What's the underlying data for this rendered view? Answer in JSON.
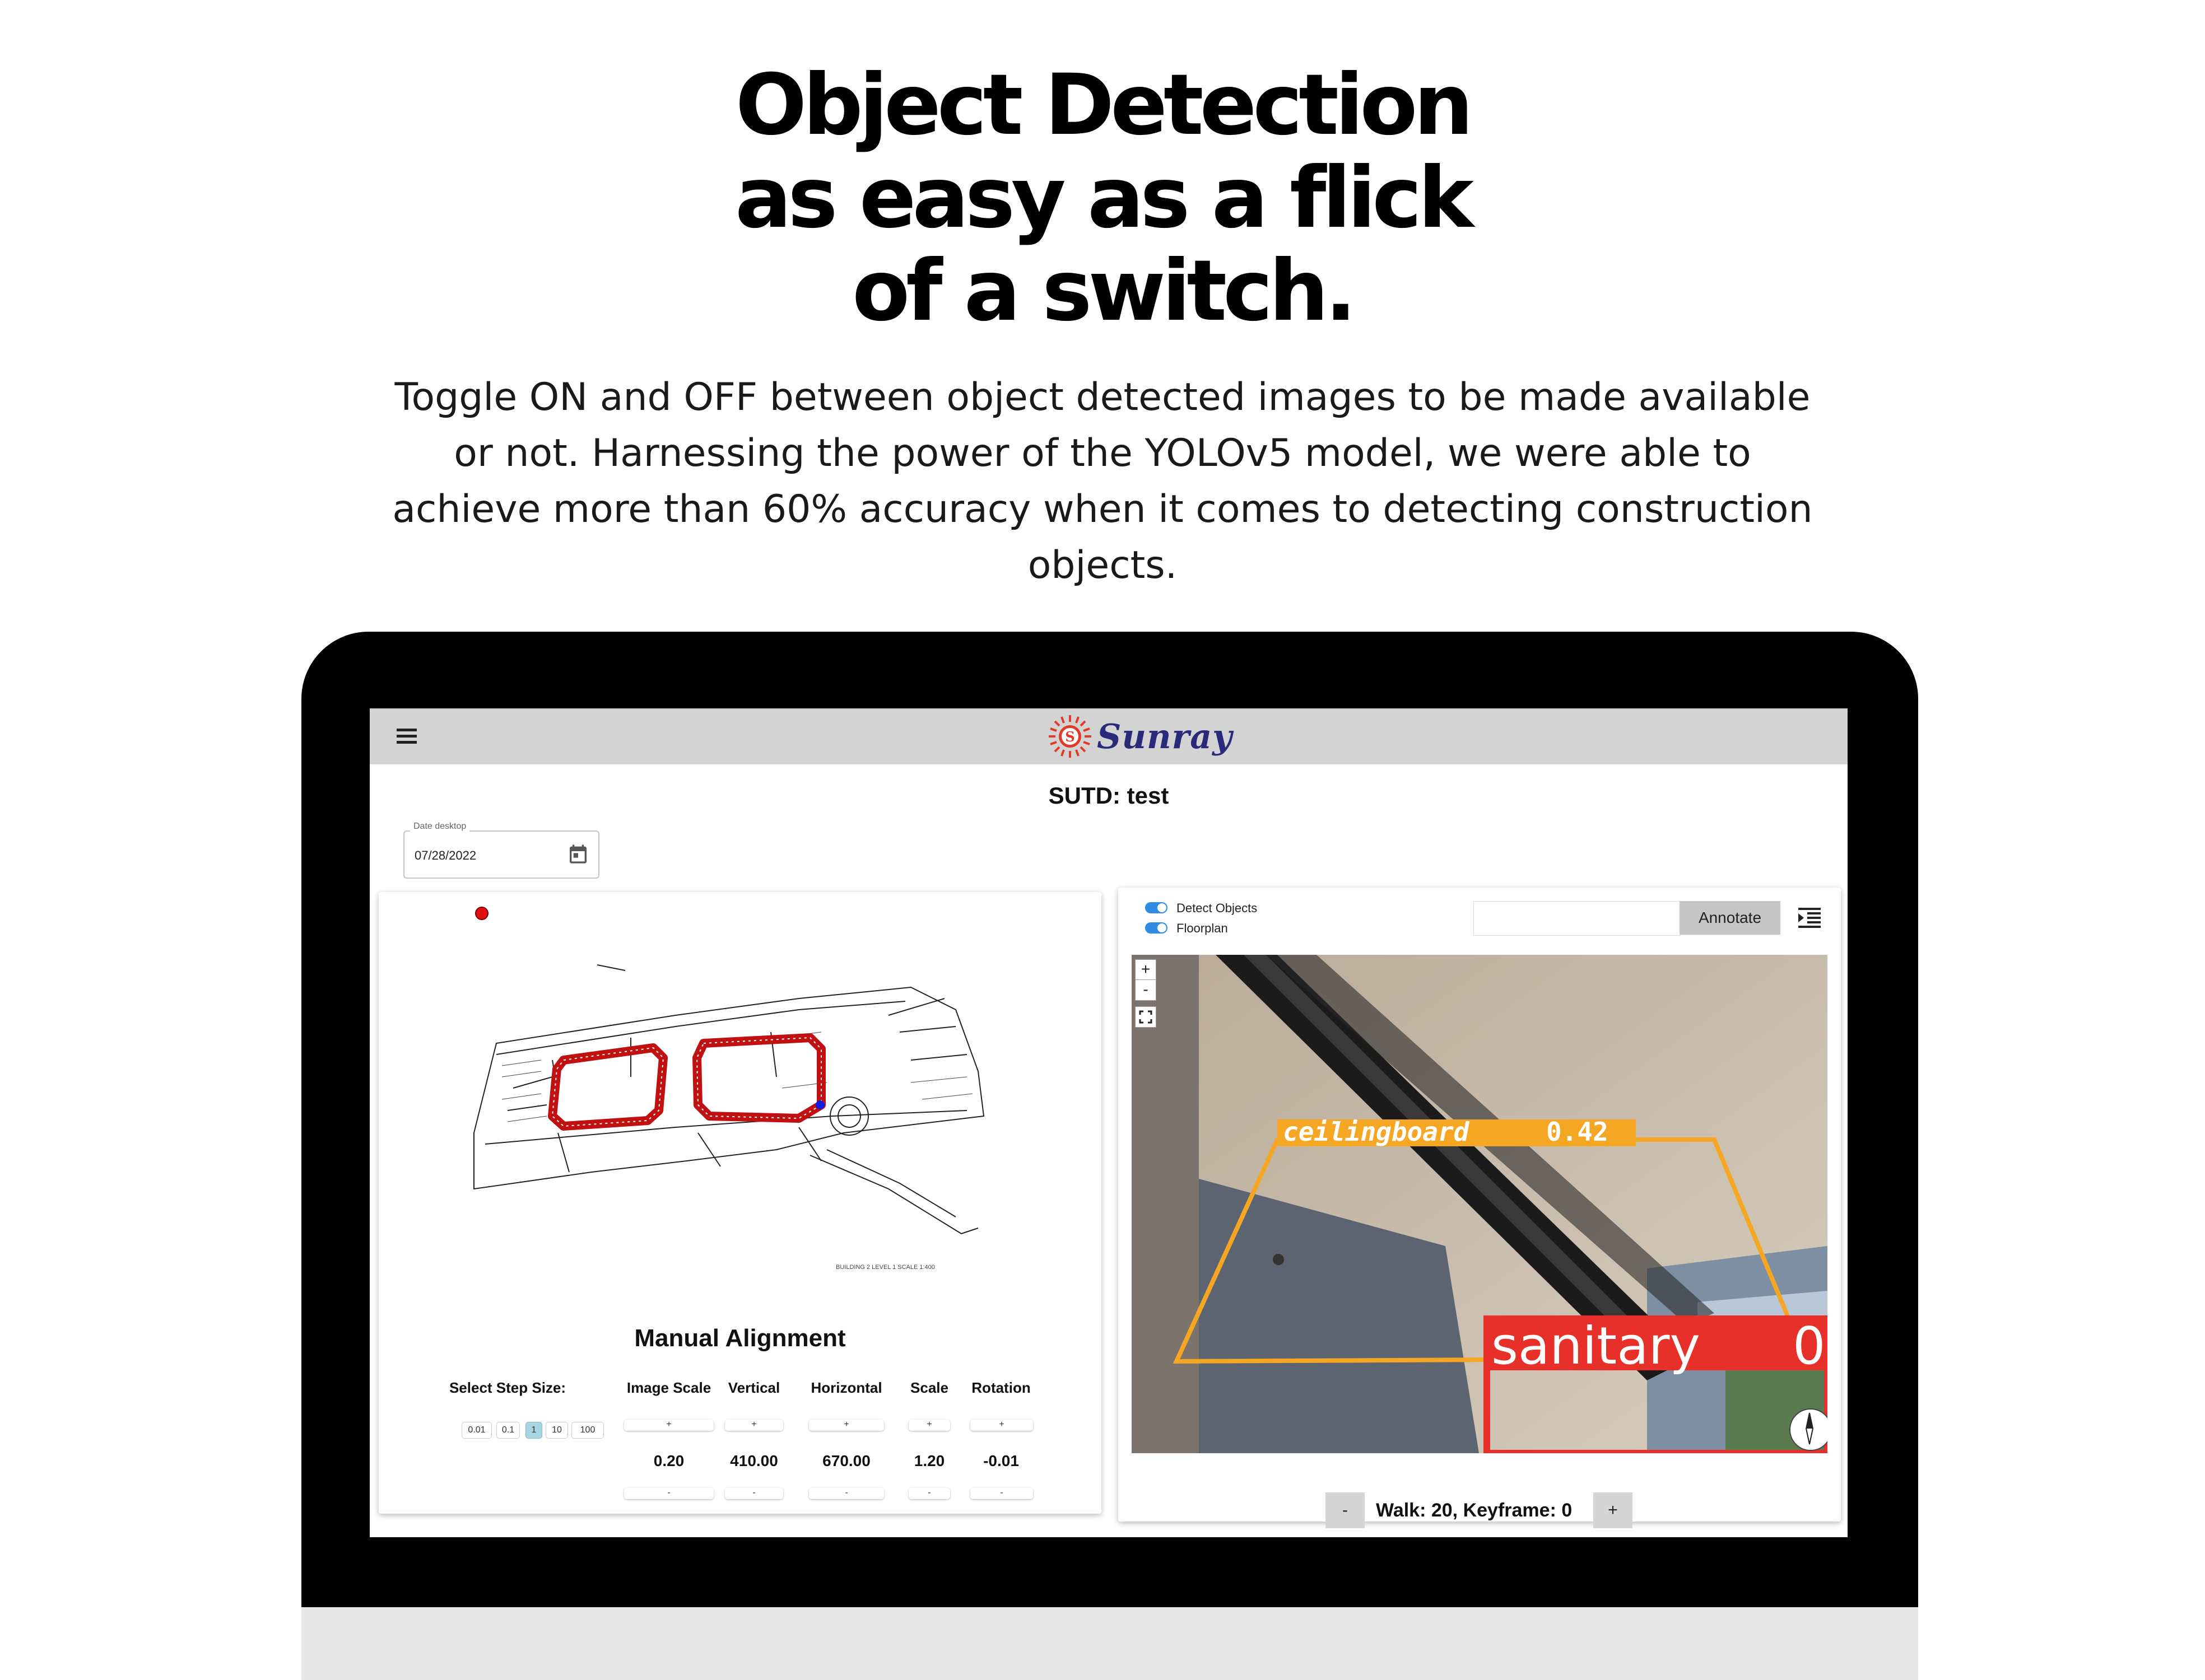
{
  "headline": {
    "line1": "Object Detection",
    "line2": "as easy as a flick",
    "line3": "of a switch."
  },
  "description": "Toggle ON and OFF between object detected images to be made available or not. Harnessing the power of the YOLOv5 model, we were able to achieve more than 60% accuracy when it comes to detecting construction objects.",
  "app": {
    "logo_text": "Sunray",
    "logo_badge": "S",
    "icons": {
      "menu": "menu-icon",
      "calendar": "calendar-icon",
      "list": "list-indent-icon",
      "fullscreen": "fullscreen-icon",
      "compass": "compass-icon",
      "logo": "sun-logo-icon"
    },
    "colors": {
      "appbar": "#d3d3d3",
      "toggle_on": "#2f8be6",
      "detect_box": "#f5a623",
      "sanitary_box": "#e8302a",
      "active_step": "#a9d4e6",
      "path_marker": "#cc1010"
    },
    "page_title": "SUTD: test",
    "date_field": {
      "label": "Date desktop",
      "value": "07/28/2022"
    },
    "floorplan": {
      "note": "BUILDING 2 LEVEL 1    SCALE 1:400"
    },
    "manual_alignment": {
      "title": "Manual Alignment",
      "step_label": "Select Step Size:",
      "step_sizes": [
        "0.01",
        "0.1",
        "1",
        "10",
        "100"
      ],
      "active_step": "1",
      "controls": [
        {
          "label": "Image Scale",
          "value": "0.20"
        },
        {
          "label": "Vertical",
          "value": "410.00"
        },
        {
          "label": "Horizontal",
          "value": "670.00"
        },
        {
          "label": "Scale",
          "value": "1.20"
        },
        {
          "label": "Rotation",
          "value": "-0.01"
        }
      ],
      "plus": "+",
      "minus": "-"
    },
    "toggles": [
      {
        "label": "Detect Objects",
        "on": true
      },
      {
        "label": "Floorplan",
        "on": true
      }
    ],
    "annotate": {
      "input_value": "",
      "button": "Annotate"
    },
    "viewer": {
      "zoom_in": "+",
      "zoom_out": "-",
      "detections": [
        {
          "label": "ceilingboard",
          "confidence": "0.42"
        },
        {
          "label": "sanitary",
          "confidence": "0"
        }
      ]
    },
    "walk": {
      "minus": "-",
      "label": "Walk: 20, Keyframe: 0",
      "plus": "+"
    }
  }
}
